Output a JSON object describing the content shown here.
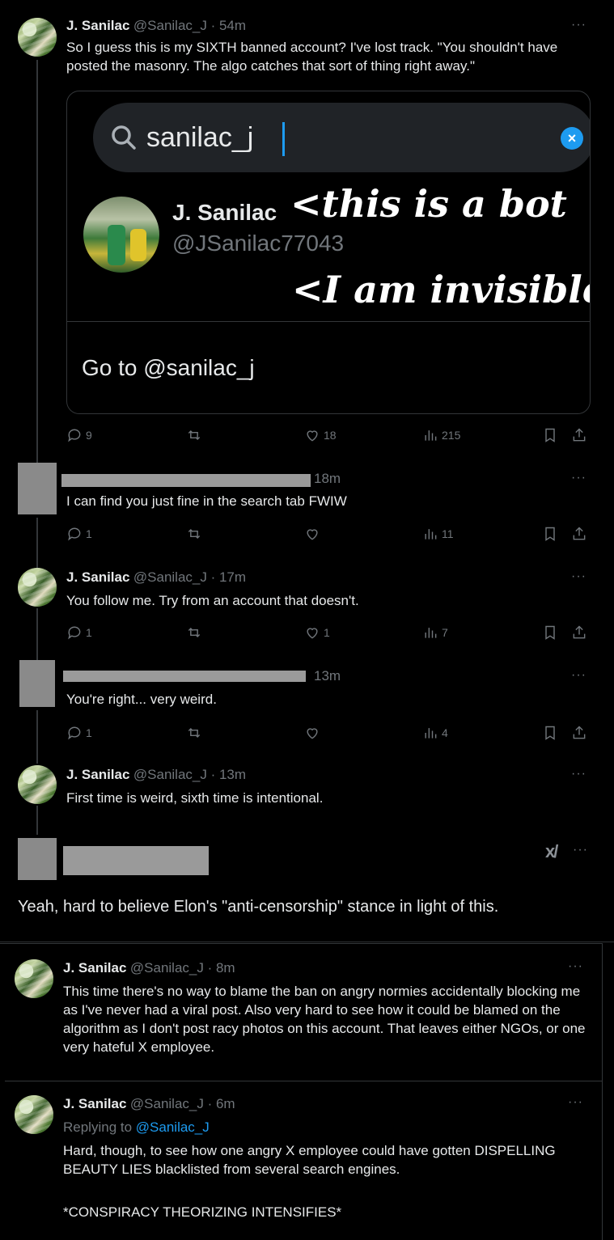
{
  "tweets": [
    {
      "name": "J. Sanilac",
      "handle": "@Sanilac_J · 54m",
      "text": "So I guess this is my SIXTH banned account? I've lost track. \"You shouldn't have posted the masonry. The algo catches that sort of thing right away.\"",
      "replies": "9",
      "likes": "18",
      "views": "215"
    },
    {
      "time": "18m",
      "text": "I can find you just fine in the search tab FWIW",
      "replies": "1",
      "views": "11"
    },
    {
      "name": "J. Sanilac",
      "handle": "@Sanilac_J · 17m",
      "text": "You follow me. Try from an account that doesn't.",
      "replies": "1",
      "likes": "1",
      "views": "7"
    },
    {
      "time": "13m",
      "text": "You're right... very weird.",
      "replies": "1",
      "views": "4"
    },
    {
      "name": "J. Sanilac",
      "handle": "@Sanilac_J · 13m",
      "text": "First time is weird, sixth time is intentional."
    },
    {
      "text": "Yeah, hard to believe Elon's \"anti-censorship\" stance in light of this."
    },
    {
      "name": "J. Sanilac",
      "handle": "@Sanilac_J · 8m",
      "text": "This time there's no way to blame the ban on angry normies accidentally blocking me as I've never had a viral post. Also very hard to see how it could be blamed on the algorithm as I don't post racy photos on this account. That leaves either NGOs, or one very hateful X employee."
    },
    {
      "name": "J. Sanilac",
      "handle": "@Sanilac_J · 6m",
      "replying_prefix": "Replying to ",
      "replying_handle": "@Sanilac_J",
      "text1": "Hard, though, to see how one angry X employee could have gotten DISPELLING BEAUTY LIES blacklisted from several search engines.",
      "text2": "*CONSPIRACY THEORIZING INTENSIFIES*"
    }
  ],
  "media": {
    "search_value": "sanilac_j",
    "result_name": "J. Sanilac",
    "result_handle": "@JSanilac77043",
    "annotation1": "<this is a bot",
    "annotation2": "<I am invisible",
    "goto_label": "Go to @sanilac_j"
  },
  "more_glyph": "···",
  "grok_label": "x/",
  "colors": {
    "link": "#1d9bf0",
    "muted": "#71767b",
    "text": "#e7e9ea"
  }
}
